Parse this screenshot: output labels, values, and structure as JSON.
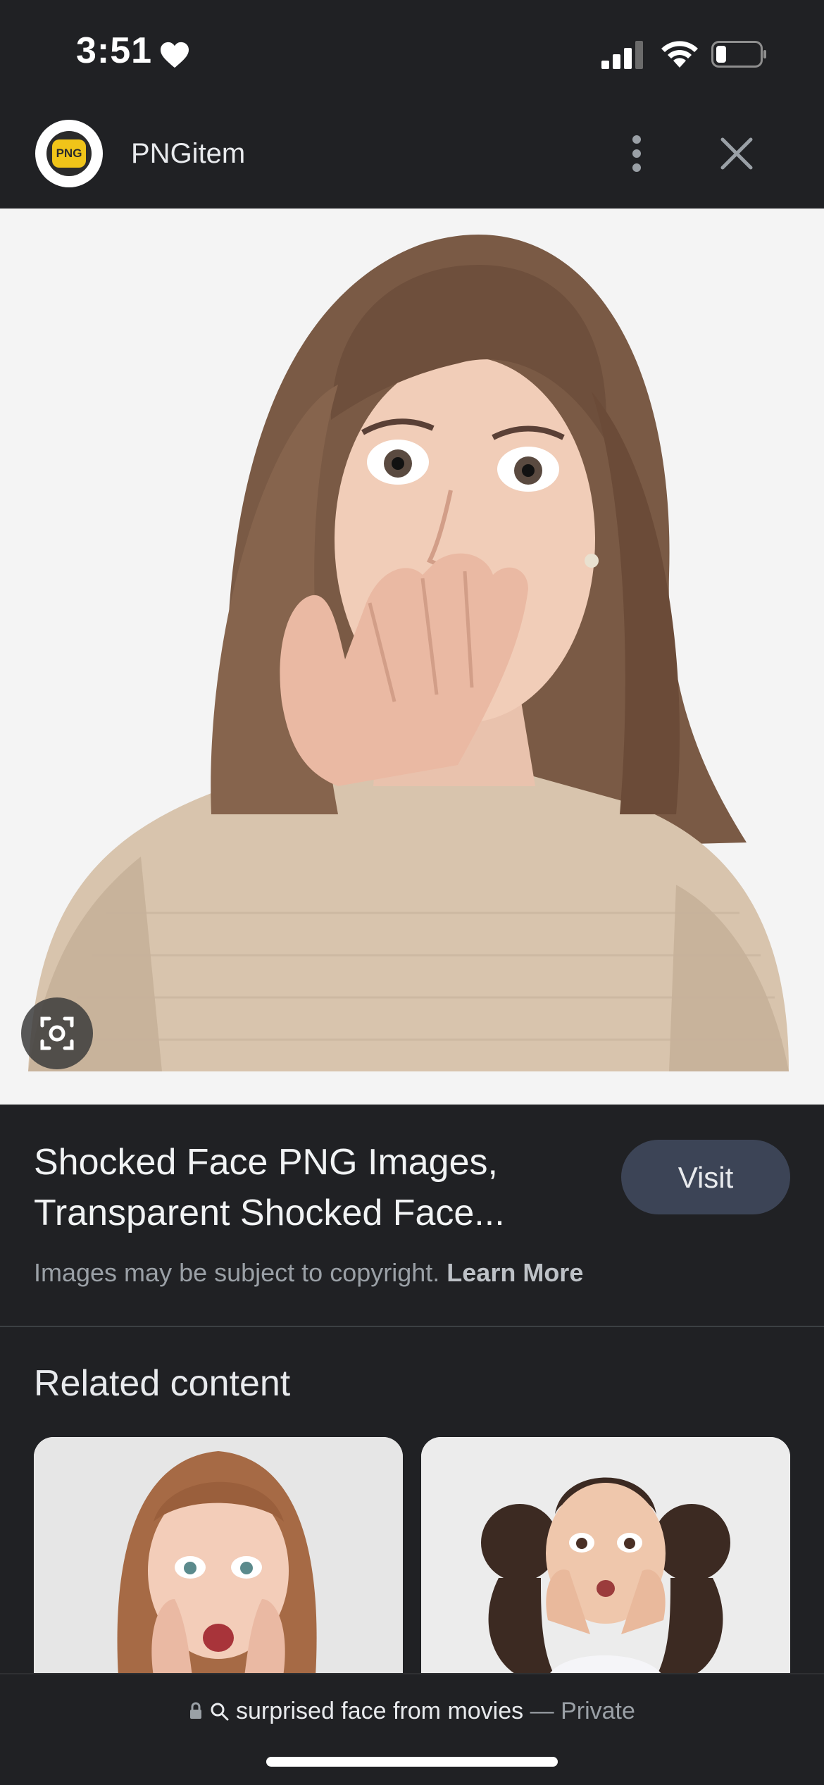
{
  "status_bar": {
    "time": "3:51"
  },
  "header": {
    "site_name": "PNGitem",
    "logo_text": "PNG"
  },
  "result": {
    "title_line1": "Shocked Face PNG Images,",
    "title_line2": "Transparent Shocked Face...",
    "visit_label": "Visit",
    "copyright_text": "Images may be subject to copyright.",
    "learn_more_label": "Learn More"
  },
  "related": {
    "heading": "Related content"
  },
  "bottom_bar": {
    "query": "surprised face from movies",
    "separator": "—",
    "mode_label": "Private"
  },
  "colors": {
    "background": "#202124",
    "visit_button": "#3c4456",
    "image_bg": "#f4f4f4"
  }
}
